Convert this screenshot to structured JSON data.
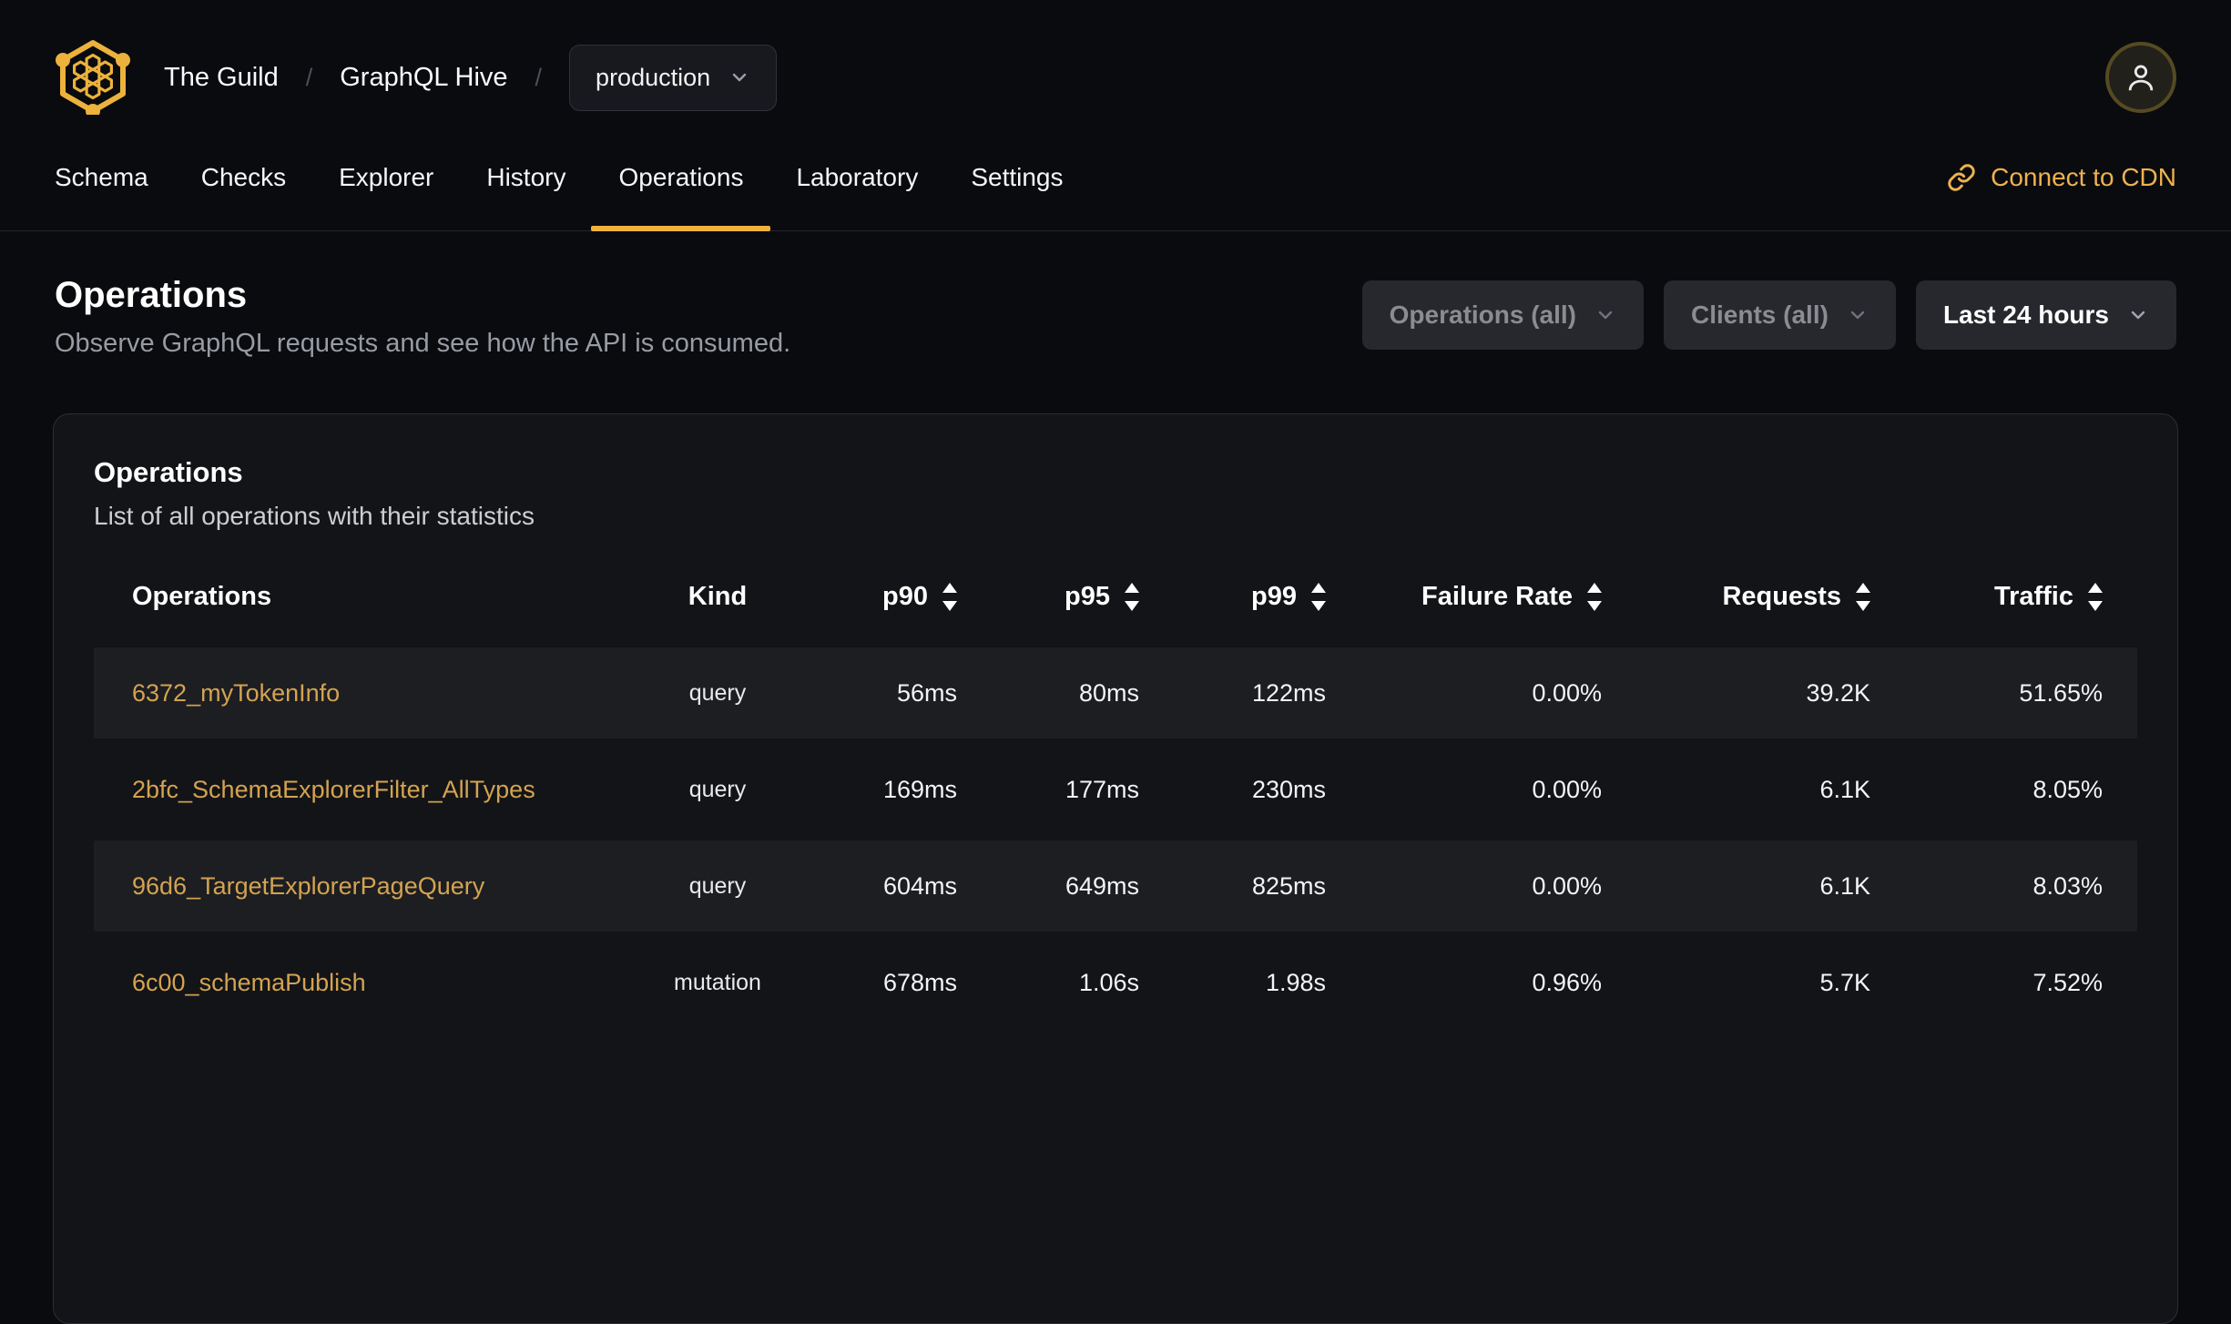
{
  "colors": {
    "accent": "#f0b13e",
    "operation_link": "#d3a351"
  },
  "header": {
    "org": "The Guild",
    "separator": "/",
    "project": "GraphQL Hive",
    "target": "production"
  },
  "nav": {
    "tabs": [
      "Schema",
      "Checks",
      "Explorer",
      "History",
      "Operations",
      "Laboratory",
      "Settings"
    ],
    "active_tab": "Operations",
    "cdn_link": "Connect to CDN"
  },
  "page": {
    "title": "Operations",
    "subtitle": "Observe GraphQL requests and see how the API is consumed.",
    "filters": {
      "operations": "Operations (all)",
      "clients": "Clients (all)",
      "period": "Last 24 hours"
    }
  },
  "card": {
    "title": "Operations",
    "subtitle": "List of all operations with their statistics",
    "table": {
      "columns": [
        "Operations",
        "Kind",
        "p90",
        "p95",
        "p99",
        "Failure Rate",
        "Requests",
        "Traffic"
      ],
      "rows": [
        {
          "name": "6372_myTokenInfo",
          "kind": "query",
          "p90": "56ms",
          "p95": "80ms",
          "p99": "122ms",
          "failure_rate": "0.00%",
          "requests": "39.2K",
          "traffic": "51.65%"
        },
        {
          "name": "2bfc_SchemaExplorerFilter_AllTypes",
          "kind": "query",
          "p90": "169ms",
          "p95": "177ms",
          "p99": "230ms",
          "failure_rate": "0.00%",
          "requests": "6.1K",
          "traffic": "8.05%"
        },
        {
          "name": "96d6_TargetExplorerPageQuery",
          "kind": "query",
          "p90": "604ms",
          "p95": "649ms",
          "p99": "825ms",
          "failure_rate": "0.00%",
          "requests": "6.1K",
          "traffic": "8.03%"
        },
        {
          "name": "6c00_schemaPublish",
          "kind": "mutation",
          "p90": "678ms",
          "p95": "1.06s",
          "p99": "1.98s",
          "failure_rate": "0.96%",
          "requests": "5.7K",
          "traffic": "7.52%"
        }
      ]
    }
  }
}
